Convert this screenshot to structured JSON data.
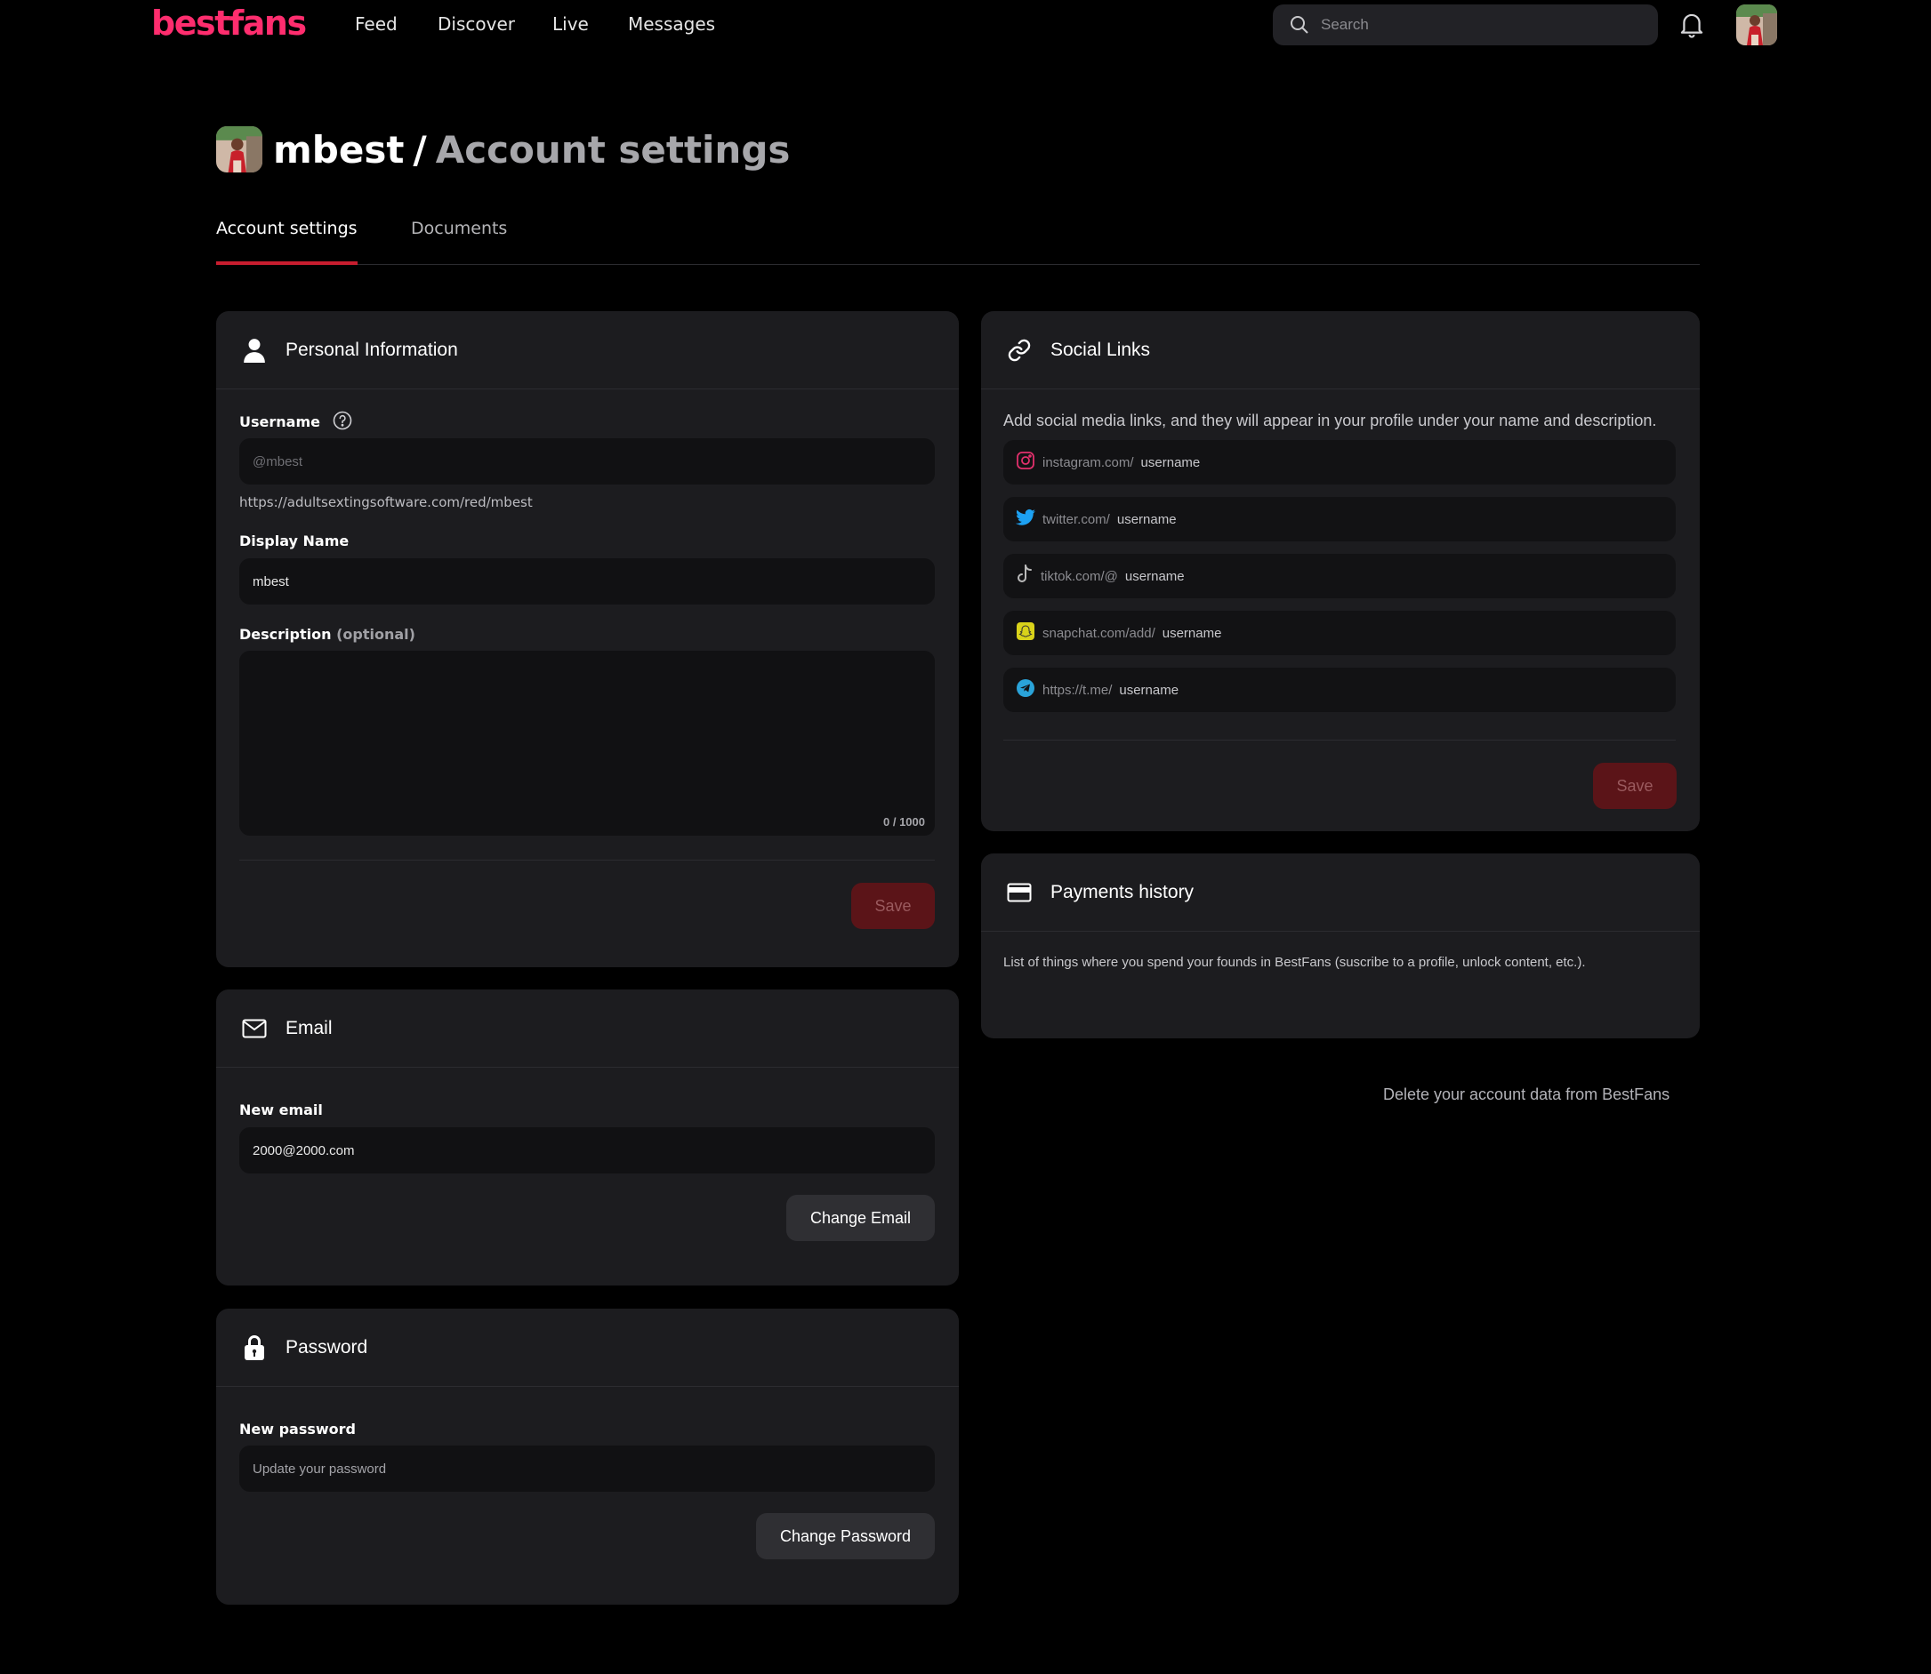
{
  "topbar": {
    "logo": "bestfans",
    "nav": [
      "Feed",
      "Discover",
      "Live",
      "Messages"
    ],
    "search_placeholder": "Search"
  },
  "header": {
    "username": "mbest",
    "separator": "/",
    "page": "Account settings"
  },
  "tabs": [
    "Account settings",
    "Documents"
  ],
  "personal": {
    "title": "Personal Information",
    "username_label": "Username",
    "username_placeholder": "@mbest",
    "profile_url": "https://adultsextingsoftware.com/red/mbest",
    "display_label": "Display Name",
    "display_value": "mbest",
    "description_label": "Description",
    "description_optional": "(optional)",
    "counter": "0 / 1000",
    "save": "Save"
  },
  "email": {
    "title": "Email",
    "label": "New email",
    "value": "2000@2000.com",
    "button": "Change Email"
  },
  "password": {
    "title": "Password",
    "label": "New password",
    "placeholder": "Update your password",
    "button": "Change Password"
  },
  "social": {
    "title": "Social Links",
    "description": "Add social media links, and they will appear in your profile under your name and description.",
    "links": [
      {
        "prefix": "instagram.com/",
        "placeholder": "username",
        "icon": "instagram-icon",
        "color": "#e1306c"
      },
      {
        "prefix": "twitter.com/",
        "placeholder": "username",
        "icon": "twitter-icon",
        "color": "#1da1f2"
      },
      {
        "prefix": "tiktok.com/@",
        "placeholder": "username",
        "icon": "tiktok-icon",
        "color": "#bbbbbb"
      },
      {
        "prefix": "snapchat.com/add/",
        "placeholder": "username",
        "icon": "snapchat-icon",
        "color": "#d9d21a"
      },
      {
        "prefix": "https://t.me/",
        "placeholder": "username",
        "icon": "telegram-icon",
        "color": "#2aa3d9"
      }
    ],
    "save": "Save"
  },
  "payments": {
    "title": "Payments history",
    "description": "List of things where you spend your founds in BestFans (suscribe to a profile, unlock content, etc.)."
  },
  "delete_link": "Delete your account data from BestFans",
  "colors": {
    "brand": "#ff2d6e",
    "accent": "#c81d2f",
    "background": "#000000",
    "card": "#1c1c1f"
  }
}
